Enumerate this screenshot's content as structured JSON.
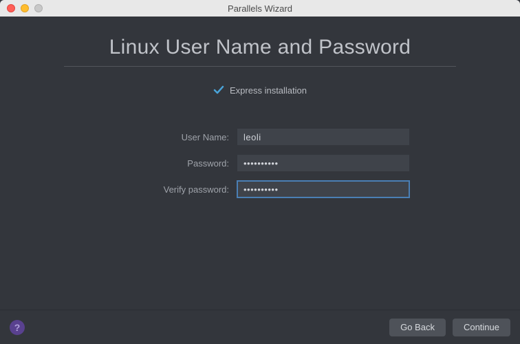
{
  "window": {
    "title": "Parallels Wizard"
  },
  "heading": "Linux User Name and Password",
  "express": {
    "label": "Express installation",
    "checked": true
  },
  "form": {
    "username": {
      "label": "User Name:",
      "value": "leoli"
    },
    "password": {
      "label": "Password:",
      "value": "••••••••••"
    },
    "verify": {
      "label": "Verify password:",
      "value": "••••••••••"
    }
  },
  "footer": {
    "help": "?",
    "back": "Go Back",
    "continue": "Continue"
  }
}
